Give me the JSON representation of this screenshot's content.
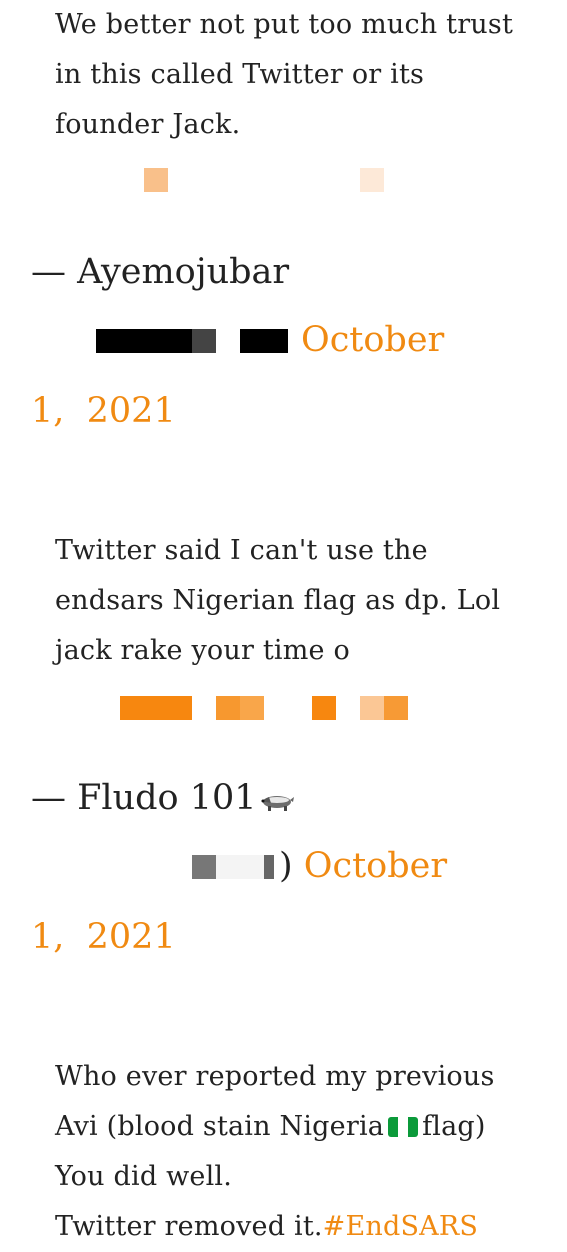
{
  "tweet1": {
    "text": "We better not put too much trust in this called Twitter or its founder Jack.",
    "author": "— Ayemojubar",
    "date": "October 1,  2021"
  },
  "tweet2": {
    "text": "Twitter said I can't use the endsars Nigerian flag as dp. Lol jack rake your time o",
    "author": "— Fludo 101",
    "date": "October 1,  2021"
  },
  "tweet3": {
    "line1": "Who ever reported my previous",
    "line2_a": "Avi (blood stain Nigeria",
    "line2_b": "flag)",
    "line3": "You did well.",
    "line4": "Twitter removed it.",
    "hashtag": "#EndSARS"
  },
  "colors": {
    "link": "#f08a12",
    "text": "#222222"
  },
  "icons": {
    "badger": "badger-emoji",
    "flag": "nigeria-flag-emoji"
  }
}
